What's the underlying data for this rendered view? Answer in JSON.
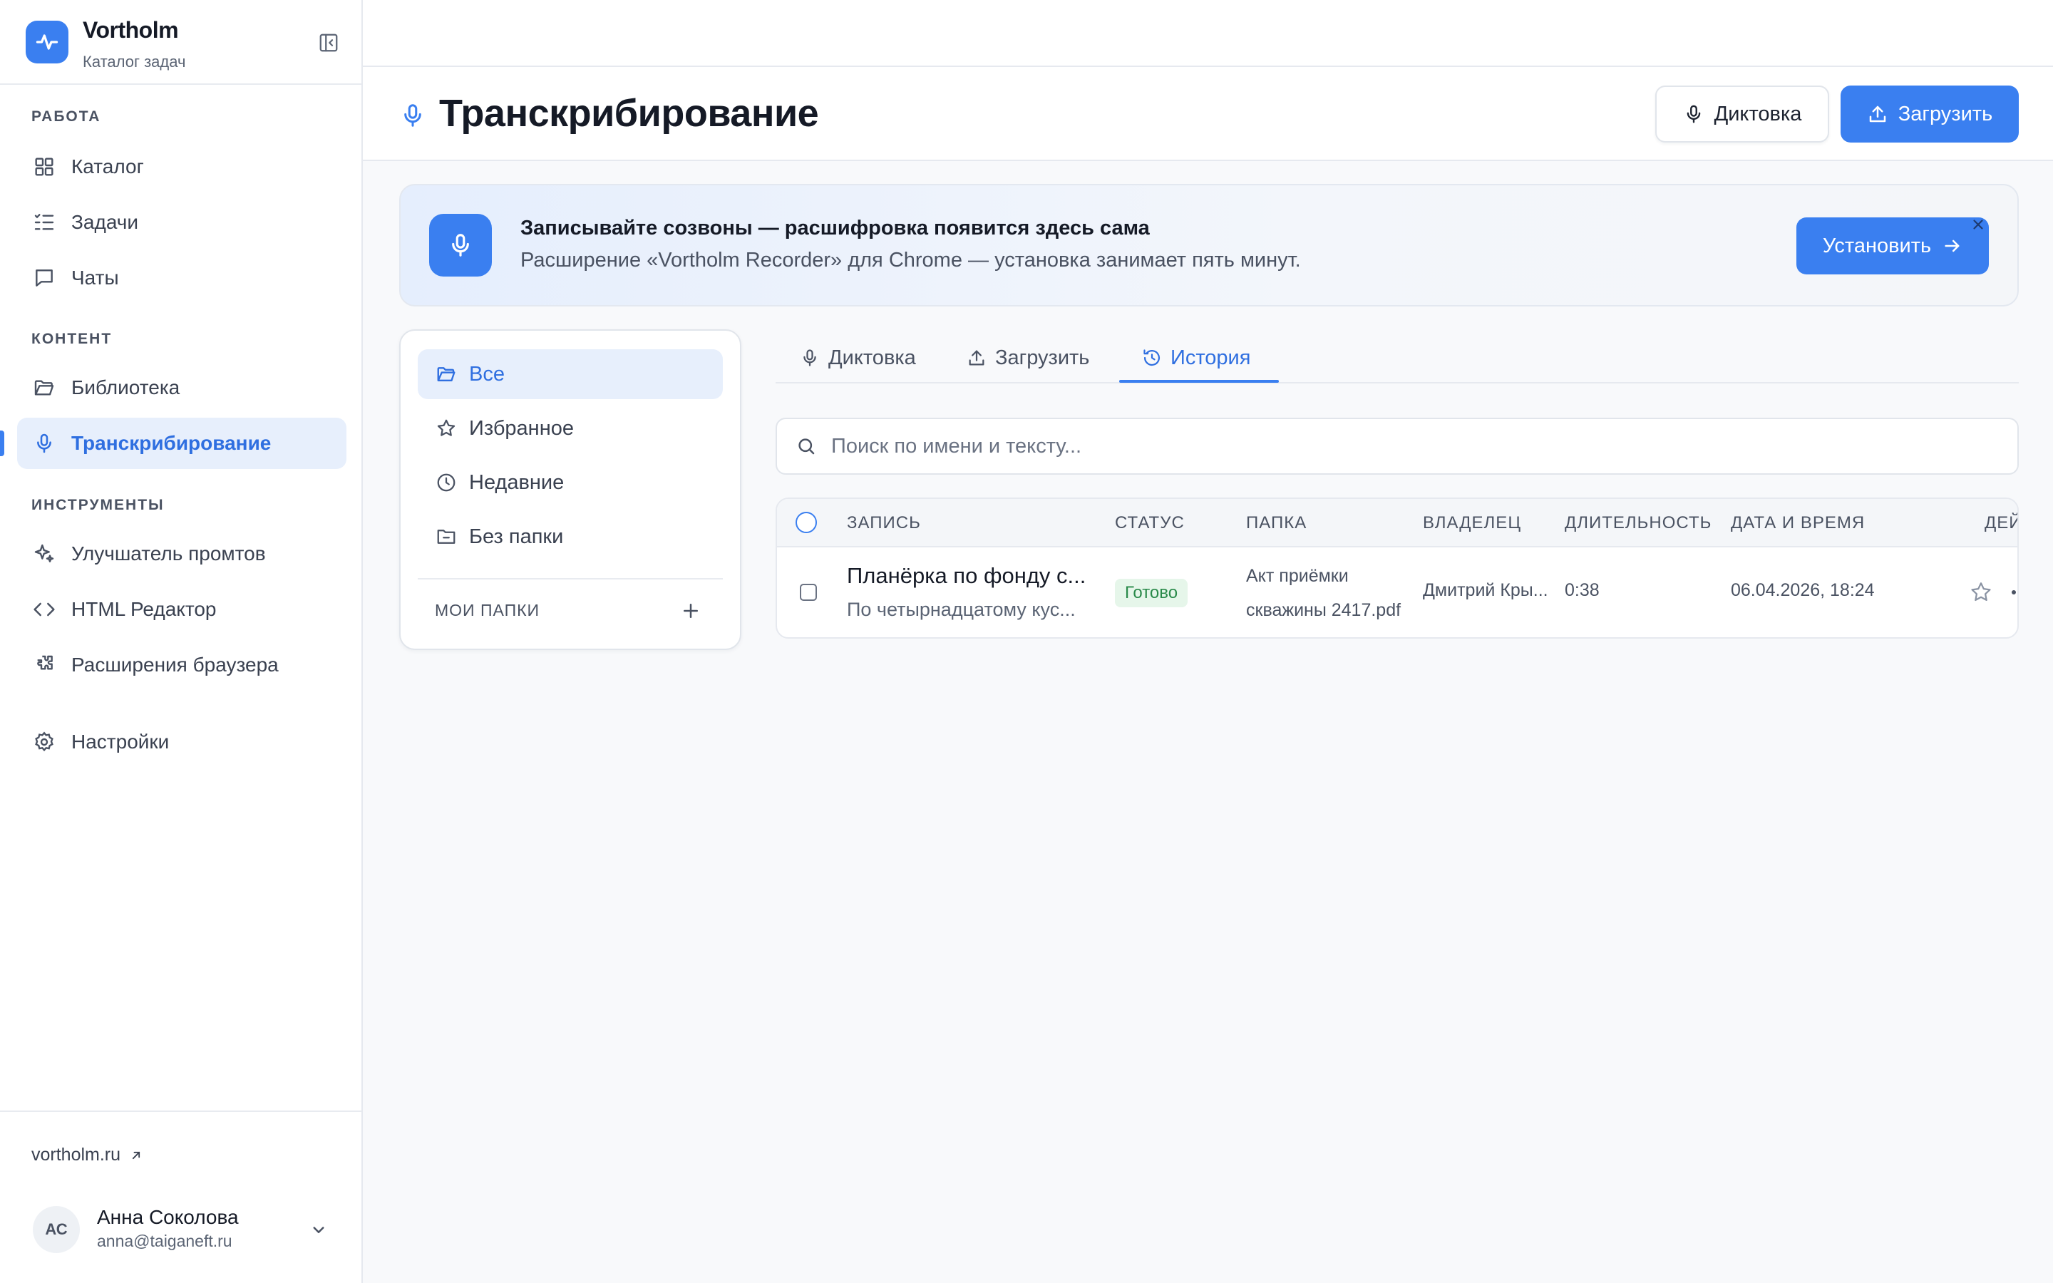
{
  "brand": {
    "name": "Vortholm",
    "subtitle": "Каталог задач"
  },
  "sidebar": {
    "sections": [
      {
        "label": "РАБОТА"
      },
      {
        "label": "КОНТЕНТ"
      },
      {
        "label": "ИНСТРУМЕНТЫ"
      }
    ],
    "items": [
      {
        "label": "Каталог",
        "icon": "grid-icon"
      },
      {
        "label": "Задачи",
        "icon": "list-check-icon"
      },
      {
        "label": "Чаты",
        "icon": "chat-bubble-icon"
      },
      {
        "label": "Библиотека",
        "icon": "folder-open-icon"
      },
      {
        "label": "Транскрибирование",
        "icon": "microphone-icon",
        "active": true
      },
      {
        "label": "Улучшатель промтов",
        "icon": "sparkles-icon"
      },
      {
        "label": "HTML Редактор",
        "icon": "code-brackets-icon"
      },
      {
        "label": "Расширения браузера",
        "icon": "puzzle-icon"
      },
      {
        "label": "Настройки",
        "icon": "gear-icon"
      }
    ],
    "site_link": "vortholm.ru",
    "user": {
      "initials": "АС",
      "name": "Анна Соколова",
      "email": "anna@taiganeft.ru"
    }
  },
  "header": {
    "title": "Транскрибирование",
    "dictation_label": "Диктовка",
    "upload_label": "Загрузить"
  },
  "banner": {
    "title": "Записывайте созвоны — расшифровка появится здесь сама",
    "text": "Расширение «Vortholm Recorder» для Chrome — установка занимает пять минут.",
    "install_label": "Установить"
  },
  "folders": {
    "items": [
      {
        "label": "Все",
        "icon": "folder-open-icon",
        "active": true
      },
      {
        "label": "Избранное",
        "icon": "star-icon"
      },
      {
        "label": "Недавние",
        "icon": "clock-icon"
      },
      {
        "label": "Без папки",
        "icon": "folder-minus-icon"
      }
    ],
    "my_folders_label": "МОИ ПАПКИ"
  },
  "tabs": [
    {
      "label": "Диктовка",
      "icon": "microphone-icon"
    },
    {
      "label": "Загрузить",
      "icon": "upload-icon"
    },
    {
      "label": "История",
      "icon": "history-icon",
      "active": true
    }
  ],
  "search": {
    "placeholder": "Поиск по имени и тексту...",
    "value": ""
  },
  "table": {
    "columns": [
      "ЗАПИСЬ",
      "СТАТУС",
      "ПАПКА",
      "ВЛАДЕЛЕЦ",
      "ДЛИТЕЛЬНОСТЬ",
      "ДАТА И ВРЕМЯ",
      "ДЕЙ"
    ],
    "rows": [
      {
        "title": "Планёрка по фонду с...",
        "subtitle": "По четырнадцатому кус...",
        "status": "Готово",
        "folder_line1": "Акт приёмки",
        "folder_line2": "скважины 2417.pdf",
        "owner": "Дмитрий Кры...",
        "duration": "0:38",
        "datetime": "06.04.2026, 18:24"
      }
    ]
  },
  "colors": {
    "accent": "#3a7ff0",
    "accent_soft": "#e7effc",
    "status_ready": "#2a8a4a"
  }
}
